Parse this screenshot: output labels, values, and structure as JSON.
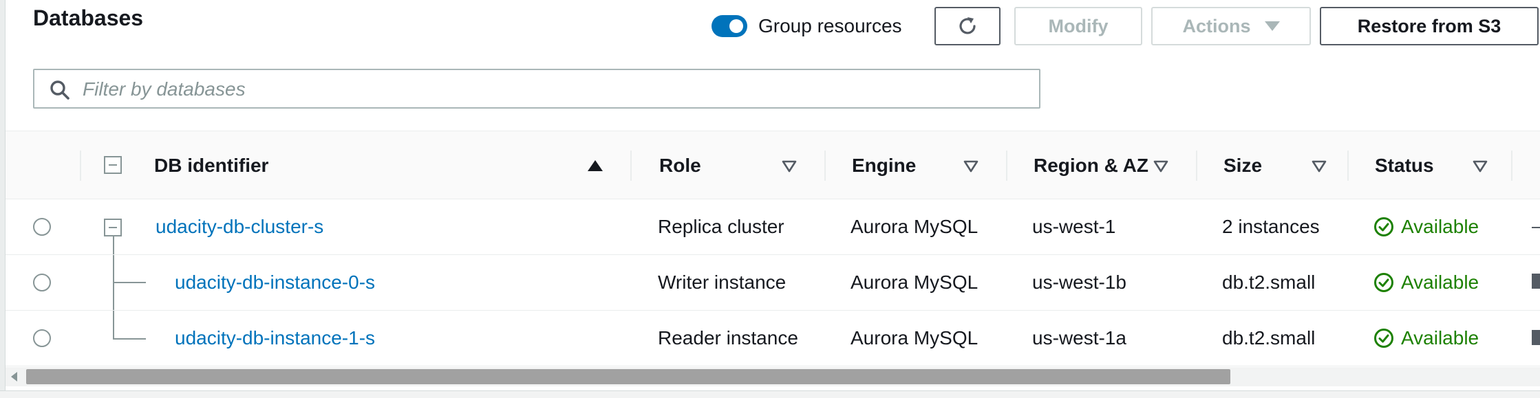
{
  "header": {
    "title": "Databases",
    "group_toggle": {
      "label": "Group resources",
      "on": true
    },
    "buttons": {
      "refresh_icon": "refresh-icon",
      "modify": "Modify",
      "actions": "Actions",
      "restore": "Restore from S3"
    }
  },
  "search": {
    "placeholder": "Filter by databases",
    "value": ""
  },
  "table": {
    "columns": {
      "db_identifier": "DB identifier",
      "role": "Role",
      "engine": "Engine",
      "region": "Region & AZ",
      "size": "Size",
      "status": "Status"
    },
    "rows": [
      {
        "id": "udacity-db-cluster-s",
        "role": "Replica cluster",
        "engine": "Aurora MySQL",
        "region": "us-west-1",
        "size": "2 instances",
        "status": "Available"
      },
      {
        "id": "udacity-db-instance-0-s",
        "role": "Writer instance",
        "engine": "Aurora MySQL",
        "region": "us-west-1b",
        "size": "db.t2.small",
        "status": "Available"
      },
      {
        "id": "udacity-db-instance-1-s",
        "role": "Reader instance",
        "engine": "Aurora MySQL",
        "region": "us-west-1a",
        "size": "db.t2.small",
        "status": "Available"
      }
    ]
  },
  "colors": {
    "accent": "#0073bb",
    "status_ok": "#1d8102",
    "text": "#16191f",
    "disabled": "#aab7b8"
  }
}
